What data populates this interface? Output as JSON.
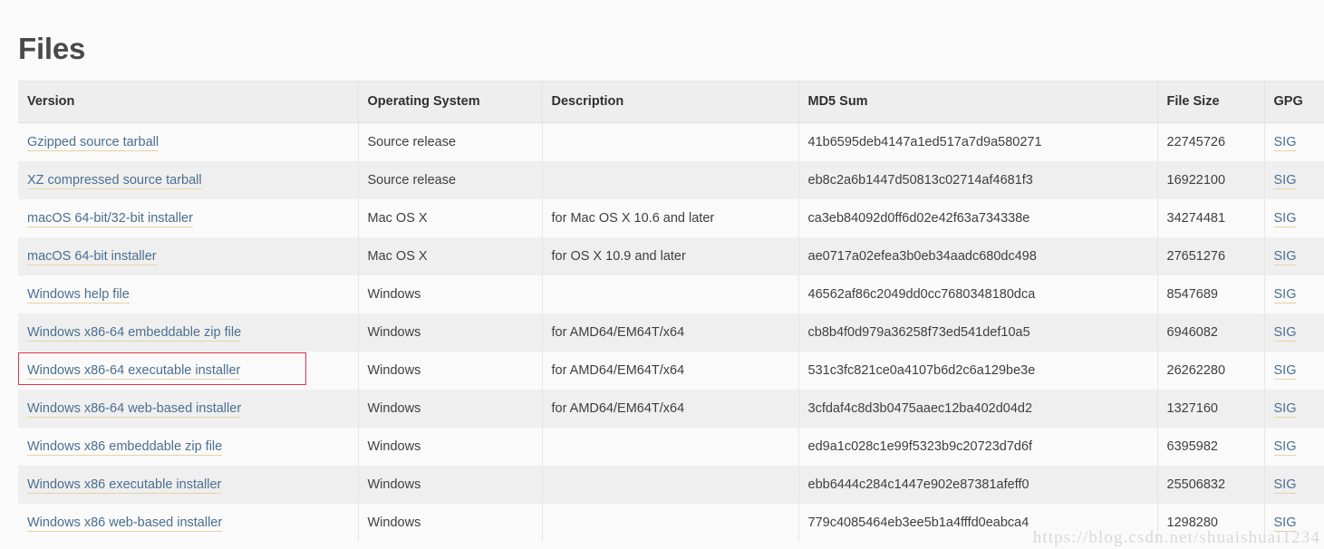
{
  "page": {
    "title": "Files",
    "watermark": "https://blog.csdn.net/shuaishuai1234"
  },
  "table": {
    "headers": {
      "version": "Version",
      "os": "Operating System",
      "description": "Description",
      "md5": "MD5 Sum",
      "size": "File Size",
      "gpg": "GPG"
    },
    "gpg_link_label": "SIG",
    "highlighted_row_index": 6,
    "rows": [
      {
        "version": "Gzipped source tarball",
        "os": "Source release",
        "description": "",
        "md5": "41b6595deb4147a1ed517a7d9a580271",
        "size": "22745726",
        "gpg": "SIG"
      },
      {
        "version": "XZ compressed source tarball",
        "os": "Source release",
        "description": "",
        "md5": "eb8c2a6b1447d50813c02714af4681f3",
        "size": "16922100",
        "gpg": "SIG"
      },
      {
        "version": "macOS 64-bit/32-bit installer",
        "os": "Mac OS X",
        "description": "for Mac OS X 10.6 and later",
        "md5": "ca3eb84092d0ff6d02e42f63a734338e",
        "size": "34274481",
        "gpg": "SIG"
      },
      {
        "version": "macOS 64-bit installer",
        "os": "Mac OS X",
        "description": "for OS X 10.9 and later",
        "md5": "ae0717a02efea3b0eb34aadc680dc498",
        "size": "27651276",
        "gpg": "SIG"
      },
      {
        "version": "Windows help file",
        "os": "Windows",
        "description": "",
        "md5": "46562af86c2049dd0cc7680348180dca",
        "size": "8547689",
        "gpg": "SIG"
      },
      {
        "version": "Windows x86-64 embeddable zip file",
        "os": "Windows",
        "description": "for AMD64/EM64T/x64",
        "md5": "cb8b4f0d979a36258f73ed541def10a5",
        "size": "6946082",
        "gpg": "SIG"
      },
      {
        "version": "Windows x86-64 executable installer",
        "os": "Windows",
        "description": "for AMD64/EM64T/x64",
        "md5": "531c3fc821ce0a4107b6d2c6a129be3e",
        "size": "26262280",
        "gpg": "SIG"
      },
      {
        "version": "Windows x86-64 web-based installer",
        "os": "Windows",
        "description": "for AMD64/EM64T/x64",
        "md5": "3cfdaf4c8d3b0475aaec12ba402d04d2",
        "size": "1327160",
        "gpg": "SIG"
      },
      {
        "version": "Windows x86 embeddable zip file",
        "os": "Windows",
        "description": "",
        "md5": "ed9a1c028c1e99f5323b9c20723d7d6f",
        "size": "6395982",
        "gpg": "SIG"
      },
      {
        "version": "Windows x86 executable installer",
        "os": "Windows",
        "description": "",
        "md5": "ebb6444c284c1447e902e87381afeff0",
        "size": "25506832",
        "gpg": "SIG"
      },
      {
        "version": "Windows x86 web-based installer",
        "os": "Windows",
        "description": "",
        "md5": "779c4085464eb3ee5b1a4fffd0eabca4",
        "size": "1298280",
        "gpg": "SIG"
      }
    ]
  },
  "colors": {
    "link": "#4a6f90",
    "header_bg": "#eeeeee",
    "row_odd_bg": "#fafafa",
    "row_even_bg": "#efefef",
    "highlight_border": "#e0334a",
    "title": "#4a4a4a"
  }
}
